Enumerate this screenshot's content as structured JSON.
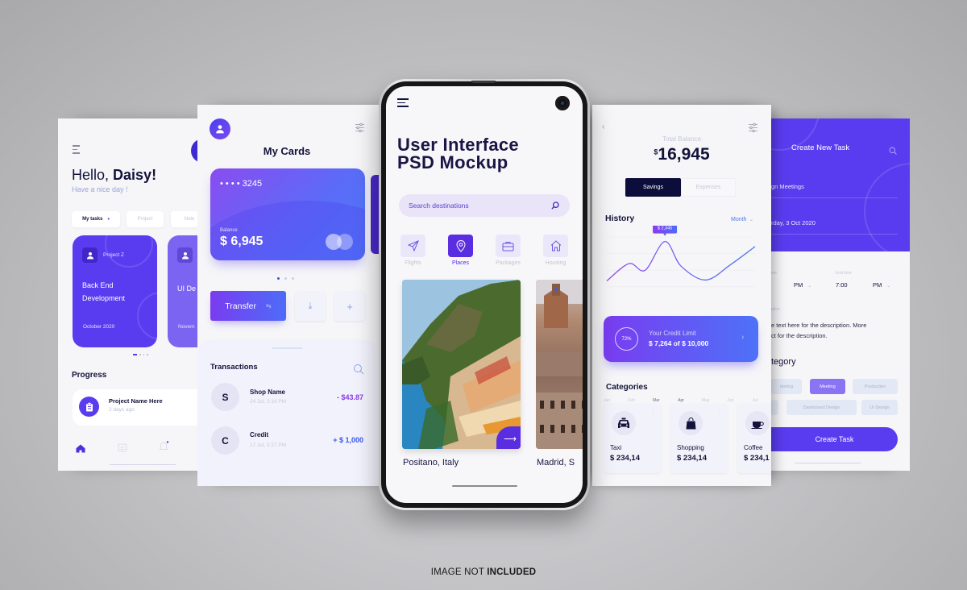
{
  "footer_note": {
    "regular": "IMAGE NOT ",
    "bold": "INCLUDED"
  },
  "colors": {
    "accent": "#5a3cf0",
    "dark": "#13123a",
    "background": "#c4c4c7"
  },
  "screen_tasks": {
    "greeting_prefix": "Hello, ",
    "greeting_name": "Daisy!",
    "subtitle": "Have a nice day !",
    "filters": [
      "My tasks",
      "Project",
      "Note"
    ],
    "projects": [
      {
        "tag": "Project Z",
        "title_line1": "Back End",
        "title_line2": "Development",
        "date": "October 2020"
      },
      {
        "tag": "",
        "title_line1": "UI De",
        "title_line2": "",
        "date": "Novem"
      }
    ],
    "progress_heading": "Progress",
    "progress_item": {
      "title": "Project Name Here",
      "time": "2 days ago"
    },
    "nav": [
      "home-icon",
      "calendar-icon",
      "bell-icon"
    ]
  },
  "screen_cards": {
    "title": "My Cards",
    "card": {
      "number": "• • • •  3245",
      "balance_label": "Balance",
      "balance": "$ 6,945"
    },
    "transfer_label": "Transfer",
    "transactions_heading": "Transactions",
    "transactions": [
      {
        "initial": "S",
        "name": "Shop Name",
        "date": "24 Jul, 3:16 PM",
        "amount": "- $43.87",
        "color": "#8a3ce8"
      },
      {
        "initial": "C",
        "name": "Credit",
        "date": "17 Jul, 5:27 PM",
        "amount": "+ $ 1,000",
        "color": "#3a56e8"
      }
    ]
  },
  "phone": {
    "title_line1": "User Interface",
    "title_line2": "PSD Mockup",
    "search_placeholder": "Search destinations",
    "categories": [
      {
        "label": "Flights",
        "icon": "paper-plane-icon",
        "active": false
      },
      {
        "label": "Places",
        "icon": "map-pin-icon",
        "active": true
      },
      {
        "label": "Packages",
        "icon": "briefcase-icon",
        "active": false
      },
      {
        "label": "Housing",
        "icon": "house-icon",
        "active": false
      }
    ],
    "destinations": [
      {
        "name": "Positano, Italy"
      },
      {
        "name": "Madrid, S"
      }
    ]
  },
  "screen_balance": {
    "total_label": "Total Balance",
    "currency": "$",
    "total": "16,945",
    "tabs": [
      {
        "label": "Savings",
        "active": true
      },
      {
        "label": "Expenses",
        "active": false
      }
    ],
    "history_heading": "History",
    "period": "Month",
    "tooltip": "$ 2,345",
    "credit": {
      "percent": "72%",
      "label": "Your Credit Limit",
      "value": "$ 7,264 of $ 10,000"
    },
    "categories_heading": "Categories",
    "categories": [
      {
        "name": "Taxi",
        "amount": "$ 234,14",
        "icon": "taxi-icon"
      },
      {
        "name": "Shopping",
        "amount": "$ 234,14",
        "icon": "shopping-bag-icon"
      },
      {
        "name": "Coffee",
        "amount": "$ 234,1",
        "icon": "coffee-cup-icon"
      }
    ]
  },
  "chart_data": {
    "type": "line",
    "title": "History",
    "categories": [
      "Jan",
      "Feb",
      "Mar",
      "Apr",
      "May",
      "Jun",
      "Jul"
    ],
    "series": [
      {
        "name": "Savings",
        "values": [
          1050,
          1620,
          1400,
          2345,
          1540,
          1080,
          1580,
          2180
        ]
      }
    ],
    "x": [
      0,
      0.9,
      1.55,
      2.35,
      3.0,
      4.0,
      5.0,
      6.0
    ],
    "highlight": {
      "label": "$ 2,345",
      "index": 3
    },
    "ylim": [
      800,
      2600
    ],
    "grid": true,
    "legend": "none"
  },
  "screen_new_task": {
    "title": "Create New Task",
    "task_name": "gn Meetings",
    "date": "rday, 3 Oct 2020",
    "start_label": "me",
    "start_period": "PM",
    "end_label": "End time",
    "end_time": "7:00",
    "end_period": "PM",
    "description_label": "ption",
    "description_line1": "e text here for the description. More",
    "description_line2": "ct for the description.",
    "category_heading": "tegory",
    "tags": [
      {
        "label": "rketing",
        "active": false
      },
      {
        "label": "Meeting",
        "active": true
      },
      {
        "label": "Production",
        "active": false
      },
      {
        "label": "",
        "active": false
      },
      {
        "label": "Dashboard Design",
        "active": false
      },
      {
        "label": "UI Design",
        "active": false
      }
    ],
    "submit_label": "Create Task"
  }
}
